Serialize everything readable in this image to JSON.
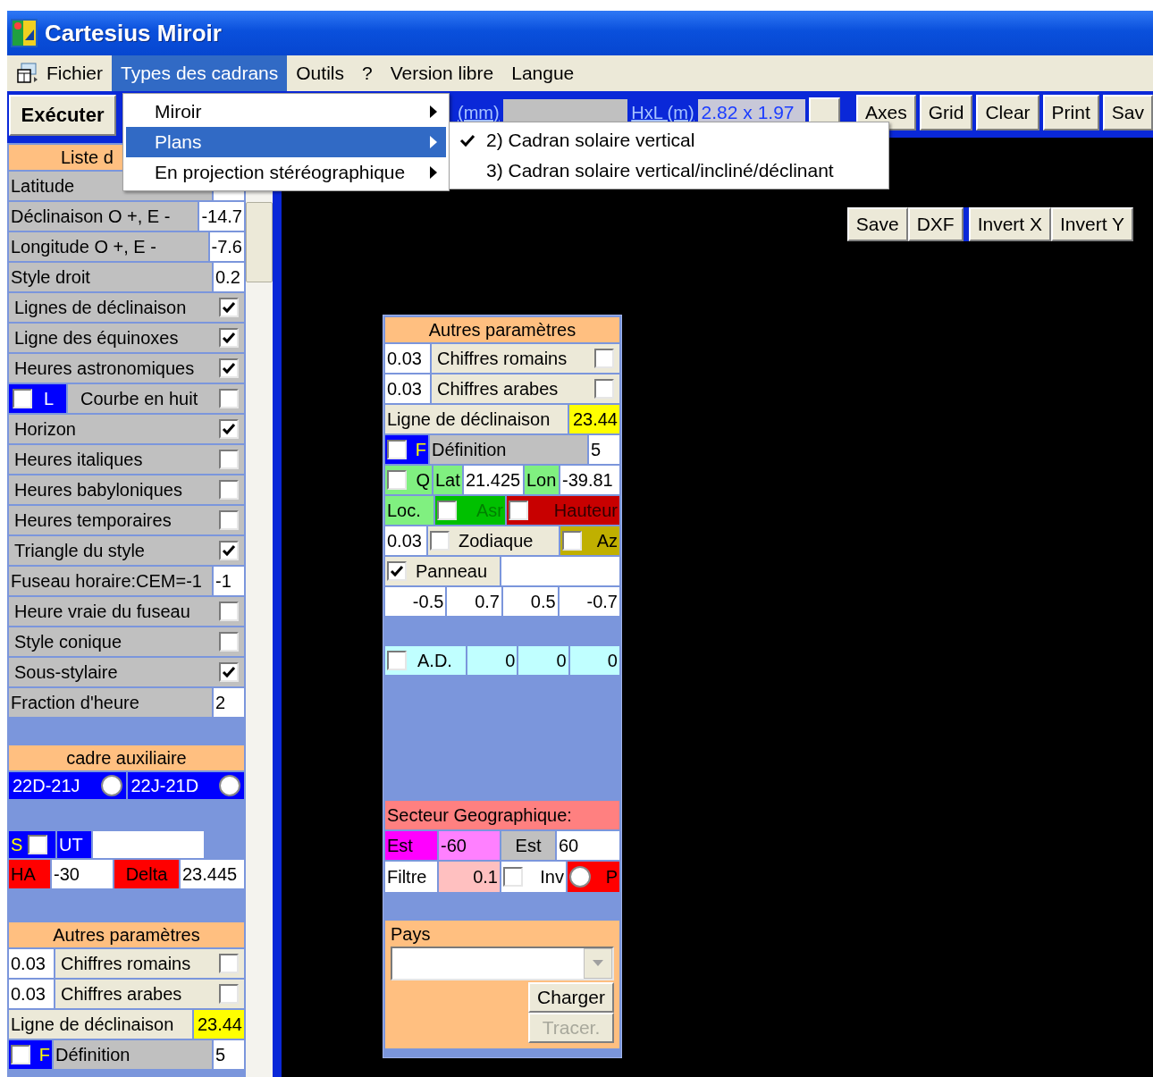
{
  "window": {
    "title": "Cartesius Miroir"
  },
  "menu_bar": [
    {
      "label": "Fichier",
      "selected": false
    },
    {
      "label": "Types des cadrans",
      "selected": true
    },
    {
      "label": "Outils",
      "selected": false
    },
    {
      "label": "?",
      "selected": false
    },
    {
      "label": "Version libre",
      "selected": false
    },
    {
      "label": "Langue",
      "selected": false
    }
  ],
  "dropdown": [
    {
      "label": "Miroir",
      "selected": false
    },
    {
      "label": "Plans",
      "selected": true
    },
    {
      "label": "En projection stéréographique",
      "selected": false
    }
  ],
  "submenu": [
    {
      "label": "2) Cadran solaire vertical",
      "checked": true
    },
    {
      "label": "3) Cadran solaire vertical/incliné/déclinant",
      "checked": false
    }
  ],
  "execute_button": "Exécuter",
  "toolbar": {
    "unit_label": "(mm)",
    "size_label": "HxL (m)",
    "size_value": "2.82 x 1.97",
    "buttons": [
      "Axes",
      "Grid",
      "Clear",
      "Print",
      "Sav"
    ]
  },
  "canvas_button_groups": [
    [
      "Save",
      "DXF"
    ],
    [
      "Invert X",
      "Invert Y"
    ]
  ],
  "left_panel": {
    "header": "Liste d",
    "rows": [
      {
        "kind": "field",
        "label": "Latitude"
      },
      {
        "kind": "field",
        "label": "Déclinaison O +, E -",
        "value": "-14.7"
      },
      {
        "kind": "field",
        "label": "Longitude O +, E -",
        "value": "-7.6"
      },
      {
        "kind": "field",
        "label": "Style droit",
        "value": "0.2"
      },
      {
        "kind": "check",
        "label": "Lignes de déclinaison",
        "checked": true
      },
      {
        "kind": "check",
        "label": "Ligne des équinoxes",
        "checked": true
      },
      {
        "kind": "check",
        "label": "Heures astronomiques",
        "checked": true
      },
      {
        "kind": "flag_check",
        "flag": "L",
        "flag_checked": false,
        "label": "Courbe en huit",
        "checked": false
      },
      {
        "kind": "check",
        "label": "Horizon",
        "checked": true
      },
      {
        "kind": "check",
        "label": "Heures italiques",
        "checked": false
      },
      {
        "kind": "check",
        "label": "Heures babyloniques",
        "checked": false
      },
      {
        "kind": "check",
        "label": "Heures temporaires",
        "checked": false
      },
      {
        "kind": "check",
        "label": "Triangle du style",
        "checked": true
      },
      {
        "kind": "field",
        "label": "Fuseau horaire:CEM=-1",
        "value": "-1"
      },
      {
        "kind": "check",
        "label": "Heure vraie du fuseau",
        "checked": false
      },
      {
        "kind": "check",
        "label": "Style conique",
        "checked": false
      },
      {
        "kind": "check",
        "label": "Sous-stylaire",
        "checked": true
      },
      {
        "kind": "field",
        "label": "Fraction d'heure",
        "value": "2"
      }
    ]
  },
  "aux": {
    "header": "cadre auxiliaire",
    "options": [
      {
        "label": "22D-21J",
        "selected": false
      },
      {
        "label": "22J-21D",
        "selected": false
      }
    ],
    "s_label": "S",
    "s_checked": false,
    "ut_label": "UT",
    "ha_label": "HA",
    "ha_value": "-30",
    "delta_label": "Delta",
    "delta_value": "23.445"
  },
  "left_params": {
    "header": "Autres paramètres",
    "numerals": [
      {
        "value": "0.03",
        "label": "Chiffres romains",
        "checked": false
      },
      {
        "value": "0.03",
        "label": "Chiffres arabes",
        "checked": false
      }
    ],
    "declination": {
      "label": "Ligne de déclinaison",
      "value": "23.44"
    },
    "definition": {
      "flag": "F",
      "flag_checked": false,
      "label": "Définition",
      "value": "5"
    }
  },
  "float_panel": {
    "header": "Autres paramètres",
    "numerals": [
      {
        "value": "0.03",
        "label": "Chiffres romains",
        "checked": false
      },
      {
        "value": "0.03",
        "label": "Chiffres arabes",
        "checked": false
      }
    ],
    "declination": {
      "label": "Ligne de déclinaison",
      "value": "23.44"
    },
    "definition": {
      "flag": "F",
      "flag_checked": false,
      "label": "Définition",
      "value": "5"
    },
    "q": {
      "checked": false,
      "label": "Q",
      "lat_label": "Lat",
      "lat_value": "21.425",
      "lon_label": "Lon",
      "lon_value": "-39.81"
    },
    "loc": {
      "label": "Loc.",
      "asr_label": "Asr",
      "asr_checked": false,
      "hauteur_label": "Hauteur",
      "hauteur_checked": false
    },
    "zodiac": {
      "value": "0.03",
      "checked": false,
      "label": "Zodiaque",
      "az_checked": false,
      "az_label": "Az"
    },
    "panel": {
      "checked": true,
      "label": "Panneau"
    },
    "panel_values": [
      "-0.5",
      "0.7",
      "0.5",
      "-0.7"
    ],
    "ad": {
      "checked": false,
      "label": "A.D.",
      "values": [
        "0",
        "0",
        "0"
      ]
    },
    "sector": {
      "title": "Secteur Geographique:",
      "east_label": "Est",
      "east_value": "-60",
      "west_label": "Est",
      "west_value": "60",
      "filter_label": "Filtre",
      "filter_value": "0.1",
      "inv_checked": false,
      "inv_label": "Inv",
      "p_selected": false,
      "p_label": "P"
    },
    "country": {
      "label": "Pays",
      "load_button": "Charger",
      "draw_button": "Tracer.",
      "draw_disabled": true
    }
  }
}
